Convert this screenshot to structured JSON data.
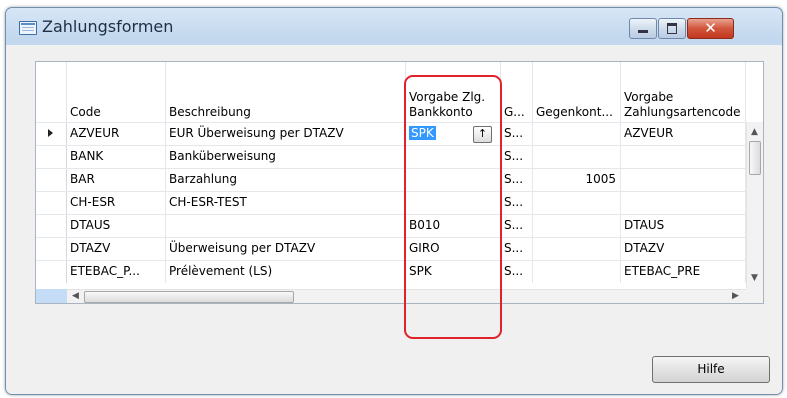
{
  "window": {
    "title": "Zahlungsformen"
  },
  "columns": [
    {
      "label": "Code"
    },
    {
      "label": "Beschreibung"
    },
    {
      "label": "Vorgabe Zlg.\nBankkonto"
    },
    {
      "label": "G..."
    },
    {
      "label": "Gegenkont..."
    },
    {
      "label": "Vorgabe\nZahlungsartencode"
    }
  ],
  "rows": [
    {
      "code": "AZVEUR",
      "beschreibung": "EUR Überweisung per DTAZV",
      "bankkonto": "SPK",
      "g": "S...",
      "gegenkonto": "",
      "zahlungsart": "AZVEUR",
      "current": true
    },
    {
      "code": "BANK",
      "beschreibung": "Banküberweisung",
      "bankkonto": "",
      "g": "S...",
      "gegenkonto": "",
      "zahlungsart": ""
    },
    {
      "code": "BAR",
      "beschreibung": "Barzahlung",
      "bankkonto": "",
      "g": "S...",
      "gegenkonto": "1005",
      "zahlungsart": ""
    },
    {
      "code": "CH-ESR",
      "beschreibung": "CH-ESR-TEST",
      "bankkonto": "",
      "g": "S...",
      "gegenkonto": "",
      "zahlungsart": ""
    },
    {
      "code": "DTAUS",
      "beschreibung": "",
      "bankkonto": "B010",
      "g": "S...",
      "gegenkonto": "",
      "zahlungsart": "DTAUS"
    },
    {
      "code": "DTAZV",
      "beschreibung": "Überweisung per DTAZV",
      "bankkonto": "GIRO",
      "g": "S...",
      "gegenkonto": "",
      "zahlungsart": "DTAZV"
    },
    {
      "code": "ETEBAC_P...",
      "beschreibung": "Prélèvement (LS)",
      "bankkonto": "SPK",
      "g": "S...",
      "gegenkonto": "",
      "zahlungsart": "ETEBAC_PRE"
    }
  ],
  "buttons": {
    "help": "Hilfe"
  },
  "colors": {
    "selection": "#3399ff",
    "highlight_box": "#e0222a",
    "selector_column": "#c4dcf6"
  },
  "icons": {
    "app": "table-form-icon",
    "lookup": "lookup-arrow-icon",
    "minimize": "minimize-icon",
    "maximize": "maximize-icon",
    "close": "close-icon"
  }
}
